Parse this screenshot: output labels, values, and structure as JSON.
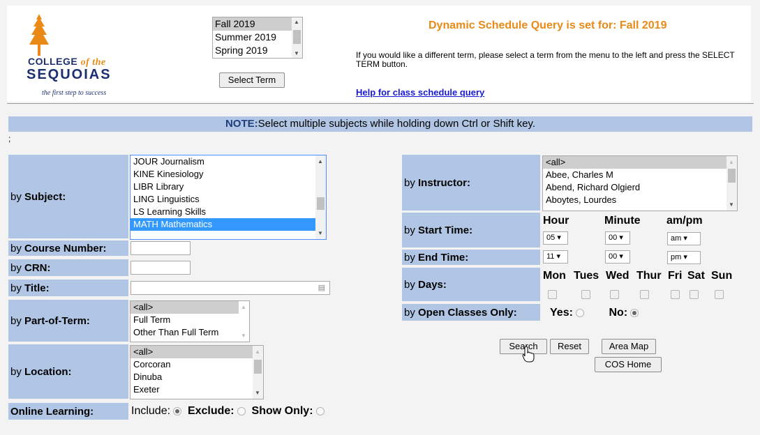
{
  "logo": {
    "college": "COLLEGE",
    "of_the": "of the",
    "sequoias": "SEQUOIAS",
    "tagline": "the first step to success"
  },
  "term": {
    "options": [
      "Fall 2019",
      "Summer 2019",
      "Spring 2019"
    ],
    "selected": "Fall 2019",
    "button": "Select Term"
  },
  "header": {
    "title": "Dynamic Schedule Query is set for: Fall 2019",
    "instructions": "If you would like a different term, please select a term from the menu to the left and press the SELECT TERM button.",
    "help_link": "Help for class schedule query"
  },
  "note": {
    "prefix": "NOTE:",
    "text": "Select multiple subjects while holding down Ctrl or Shift key."
  },
  "semicolon": ";",
  "labels": {
    "by": "by",
    "subject": "Subject:",
    "course_number": "Course Number:",
    "crn": "CRN:",
    "title": "Title:",
    "part_of_term": "Part-of-Term:",
    "location": "Location:",
    "online": "Online Learning:",
    "instructor": "Instructor:",
    "start_time": "Start Time:",
    "end_time": "End Time:",
    "days": "Days:",
    "open_classes": "Open Classes Only:"
  },
  "subjects": {
    "options": [
      "JOUR Journalism",
      "KINE Kinesiology",
      "LIBR Library",
      "LING Linguistics",
      "LS Learning Skills",
      "MATH Mathematics"
    ],
    "selected": "MATH Mathematics"
  },
  "part_of_term": {
    "options": [
      "<all>",
      "Full Term",
      "Other Than Full Term"
    ],
    "selected": "<all>"
  },
  "locations": {
    "options": [
      "<all>",
      "Corcoran",
      "Dinuba",
      "Exeter"
    ],
    "selected": "<all>"
  },
  "online": {
    "include": "Include:",
    "exclude": "Exclude:",
    "show_only": "Show Only:",
    "selected": "Include"
  },
  "instructors": {
    "options": [
      "<all>",
      "Abee, Charles M",
      "Abend, Richard Olgierd",
      "Aboytes, Lourdes"
    ],
    "selected": "<all>"
  },
  "time": {
    "hour_header": "Hour",
    "minute_header": "Minute",
    "ampm_header": "am/pm",
    "start": {
      "hour": "05",
      "minute": "00",
      "ampm": "am"
    },
    "end": {
      "hour": "11",
      "minute": "00",
      "ampm": "pm"
    }
  },
  "days": [
    "Mon",
    "Tues",
    "Wed",
    "Thur",
    "Fri",
    "Sat",
    "Sun"
  ],
  "open_classes": {
    "yes": "Yes:",
    "no": "No:",
    "selected": "No"
  },
  "buttons": {
    "search": "Search",
    "reset": "Reset",
    "area_map": "Area Map",
    "cos_home": "COS Home"
  },
  "colors": {
    "label_bg": "#b0c6e4",
    "accent_orange": "#e98a16",
    "link_blue": "#1a1ad6",
    "selection_blue": "#3399ff"
  }
}
